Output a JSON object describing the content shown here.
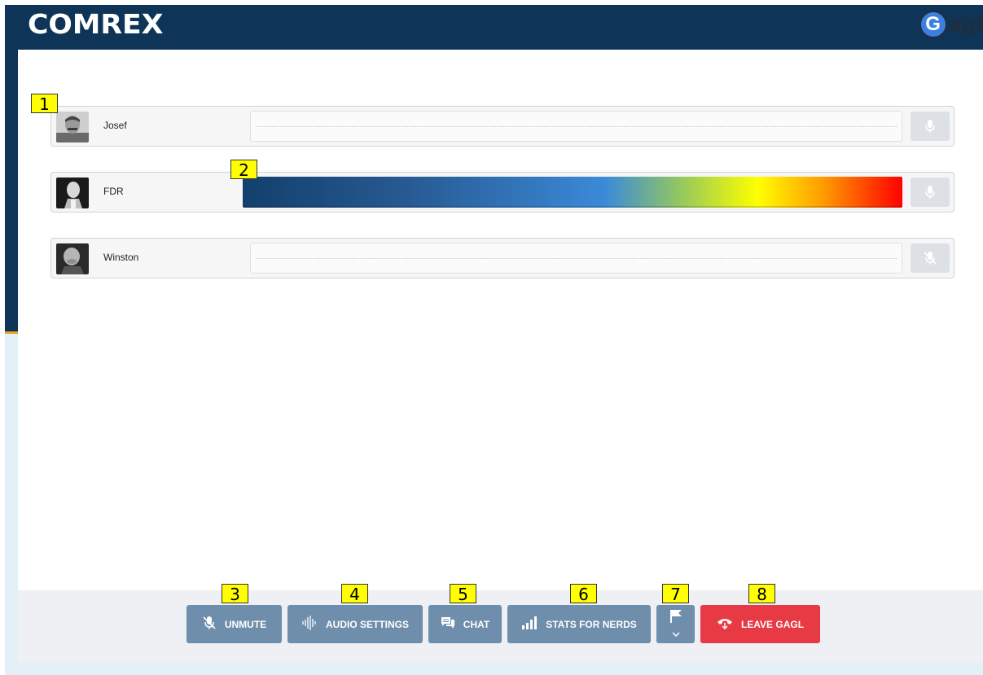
{
  "header": {
    "logo_text": "COMREX",
    "brand_letter": "G",
    "brand_text": "agl"
  },
  "participants": [
    {
      "name": "Josef",
      "level": 0,
      "mic_state": "on"
    },
    {
      "name": "FDR",
      "level": 1.0,
      "mic_state": "on"
    },
    {
      "name": "Winston",
      "level": 0,
      "mic_state": "muted"
    }
  ],
  "toolbar": {
    "unmute": "UNMUTE",
    "audio_settings": "AUDIO SETTINGS",
    "chat": "CHAT",
    "stats": "STATS FOR NERDS",
    "leave": "LEAVE GAGL"
  },
  "callouts": [
    "1",
    "2",
    "3",
    "4",
    "5",
    "6",
    "7",
    "8"
  ],
  "colors": {
    "header_bg": "#0e3558",
    "button_bg": "#6e8eab",
    "leave_bg": "#e73a44",
    "callout_bg": "#ffff00"
  }
}
